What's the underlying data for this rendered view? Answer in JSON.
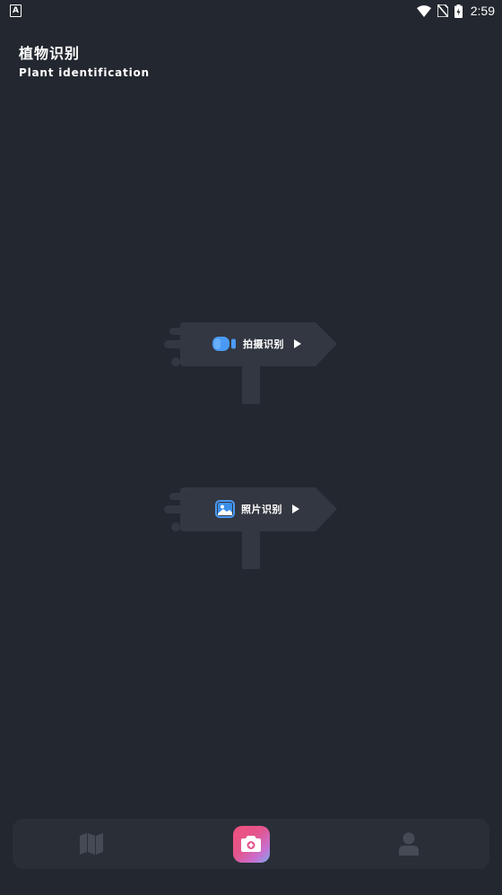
{
  "status_bar": {
    "app_icon_letter": "A",
    "time": "2:59",
    "icons": [
      "wifi-icon",
      "no-sim-icon",
      "battery-charging-icon"
    ]
  },
  "header": {
    "title_cn": "植物识别",
    "title_en": "Plant identification"
  },
  "actions": {
    "shoot": {
      "label": "拍摄识别",
      "icon": "video-camera-icon"
    },
    "photo": {
      "label": "照片识别",
      "icon": "image-icon"
    }
  },
  "bottom_nav": {
    "items": [
      {
        "name": "map",
        "icon": "map-icon"
      },
      {
        "name": "camera",
        "icon": "camera-icon",
        "active": true
      },
      {
        "name": "profile",
        "icon": "user-icon"
      }
    ]
  },
  "colors": {
    "background": "#23272f",
    "signboard": "#333741",
    "nav_background": "#2a2f37",
    "icon_blue": "#4a9af5",
    "nav_icon": "#454b55"
  }
}
